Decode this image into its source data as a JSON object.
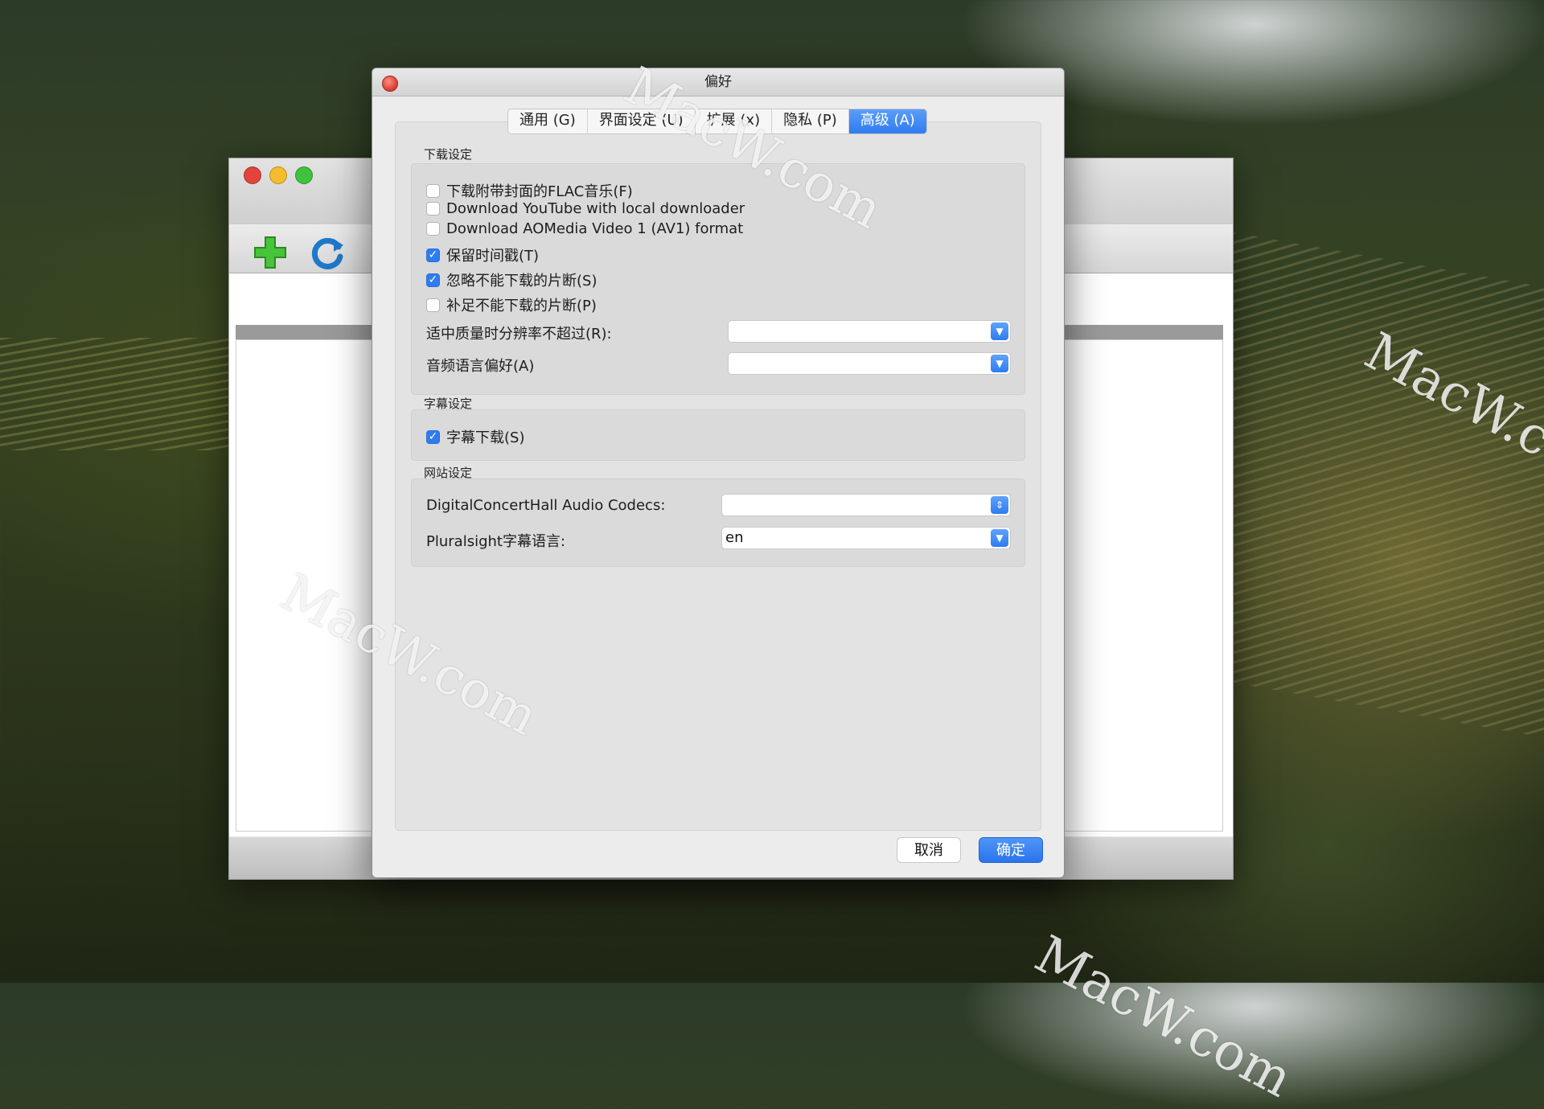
{
  "dialog": {
    "title": "偏好",
    "tabs": [
      "通用 (G)",
      "界面设定 (U)",
      "扩展 (x)",
      "隐私 (P)",
      "高级 (A)"
    ],
    "active_tab": "高级 (A)",
    "sections": {
      "download": {
        "label": "下载设定",
        "options": [
          {
            "label": "下载附带封面的FLAC音乐(F)",
            "checked": false
          },
          {
            "label": "Download YouTube with local downloader",
            "checked": false
          },
          {
            "label": "Download AOMedia Video 1 (AV1) format",
            "checked": false
          },
          {
            "label": "保留时间戳(T)",
            "checked": true
          },
          {
            "label": "忽略不能下载的片断(S)",
            "checked": true
          },
          {
            "label": "补足不能下载的片断(P)",
            "checked": false
          }
        ],
        "resolution_label": "适中质量时分辨率不超过(R):",
        "resolution_value": "",
        "audio_lang_label": "音频语言偏好(A)",
        "audio_lang_value": ""
      },
      "subtitle": {
        "label": "字幕设定",
        "options": [
          {
            "label": "字幕下载(S)",
            "checked": true
          }
        ]
      },
      "website": {
        "label": "网站设定",
        "dch_label": "DigitalConcertHall Audio Codecs:",
        "dch_value": "",
        "pluralsight_label": "Pluralsight字幕语言:",
        "pluralsight_value": "en"
      }
    },
    "buttons": {
      "cancel": "取消",
      "ok": "确定"
    }
  },
  "watermark": "MacW.com",
  "colors": {
    "accent": "#2f7cf0",
    "close": "#e0443a",
    "minimize": "#f5bd2e",
    "zoom": "#3fc33e"
  },
  "icons": [
    "close-icon",
    "add-icon",
    "refresh-icon",
    "chevron-down-icon",
    "stepper-icon",
    "checkmark-icon"
  ]
}
